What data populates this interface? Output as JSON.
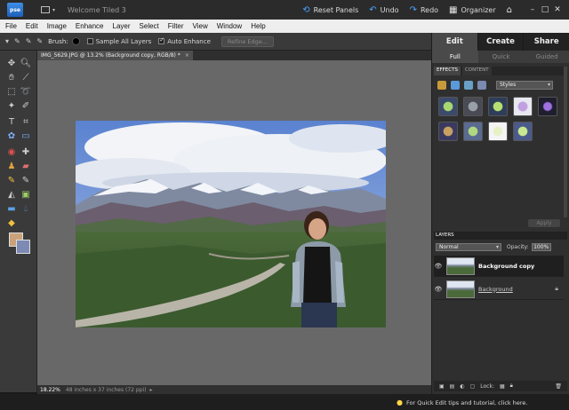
{
  "titlebar": {
    "app_badge": "pse",
    "title": "Welcome Tiled 3",
    "reset_panels": "Reset Panels",
    "undo": "Undo",
    "redo": "Redo",
    "organizer": "Organizer"
  },
  "menu": [
    "File",
    "Edit",
    "Image",
    "Enhance",
    "Layer",
    "Select",
    "Filter",
    "View",
    "Window",
    "Help"
  ],
  "options": {
    "brush_label": "Brush:",
    "sample_all_layers": "Sample All Layers",
    "auto_enhance": "Auto Enhance",
    "refine_edge": "Refine Edge..."
  },
  "document": {
    "tab_title": "IMG_5629.JPG @ 13.2% (Background copy, RGB/8) *",
    "close_glyph": "×"
  },
  "status": {
    "zoom": "18.22%",
    "doc_info": "48 inches x 37 inches (72 ppi)",
    "arrow": "▸"
  },
  "panel": {
    "mode_tabs": [
      "Edit",
      "Create",
      "Share"
    ],
    "sub_tabs": [
      "Full",
      "Quick",
      "Guided"
    ],
    "effects_tabs": [
      "EFFECTS",
      "CONTENT"
    ],
    "style_select": "Styles",
    "apply": "Apply",
    "layers_header": "LAYERS",
    "blend_mode": "Normal",
    "opacity_label": "Opacity:",
    "opacity_value": "100%",
    "layers": [
      {
        "name": "Background copy",
        "selected": true
      },
      {
        "name": "Background",
        "selected": false
      }
    ],
    "lock_label": "Lock:"
  },
  "hint": "For Quick Edit tips and tutorial, click here.",
  "colors": {
    "foreground": "#caa27a",
    "background": "#7c8ab4",
    "canvas_bg": "#686868",
    "accent": "#4aa3ff"
  }
}
